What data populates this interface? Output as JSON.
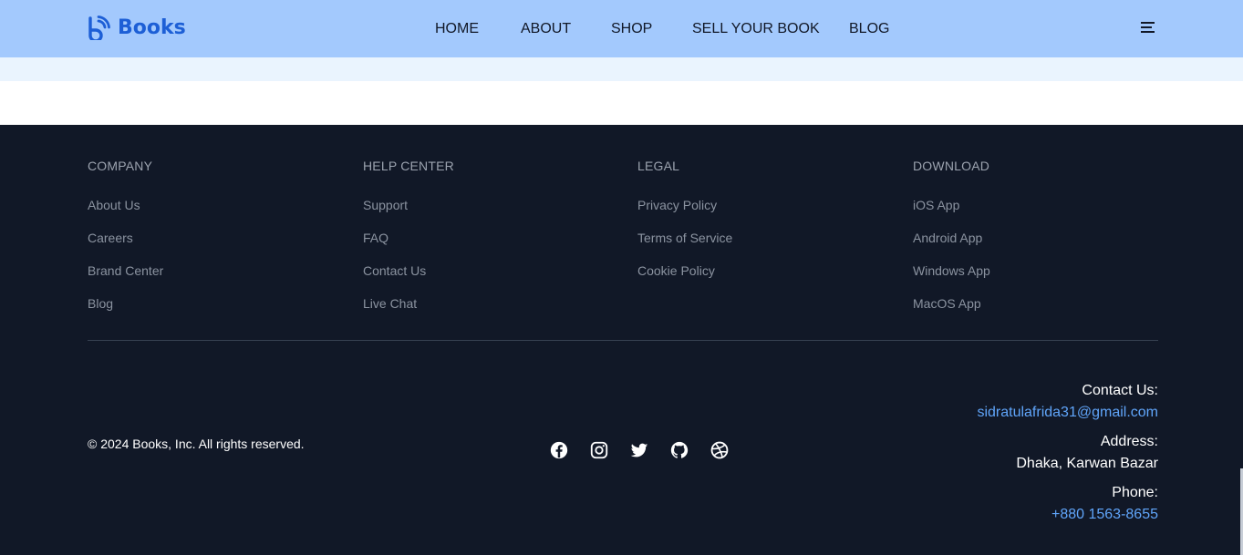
{
  "header": {
    "brand": "Books",
    "nav": [
      "HOME",
      "ABOUT",
      "SHOP",
      "SELL YOUR BOOK",
      "BLOG"
    ],
    "menu_icon": "hamburger-icon",
    "brand_icon": "books-logo-icon"
  },
  "footer": {
    "columns": [
      {
        "title": "COMPANY",
        "links": [
          "About Us",
          "Careers",
          "Brand Center",
          "Blog"
        ]
      },
      {
        "title": "HELP CENTER",
        "links": [
          "Support",
          "FAQ",
          "Contact Us",
          "Live Chat"
        ]
      },
      {
        "title": "LEGAL",
        "links": [
          "Privacy Policy",
          "Terms of Service",
          "Cookie Policy"
        ]
      },
      {
        "title": "DOWNLOAD",
        "links": [
          "iOS App",
          "Android App",
          "Windows App",
          "MacOS App"
        ]
      }
    ],
    "copyright": "© 2024 Books, Inc. All rights reserved.",
    "social_icons": [
      "facebook-icon",
      "instagram-icon",
      "twitter-icon",
      "github-icon",
      "dribbble-icon"
    ],
    "contact": {
      "contact_label": "Contact Us:",
      "email": "sidratulafrida31@gmail.com",
      "address_label": "Address:",
      "address": "Dhaka, Karwan Bazar",
      "phone_label": "Phone:",
      "phone": "+880 1563-8655"
    }
  },
  "colors": {
    "navbar_bg": "#a3c9fd",
    "brand": "#1d5fd6",
    "footer_bg": "#111827",
    "link_accent": "#60a5fa"
  }
}
